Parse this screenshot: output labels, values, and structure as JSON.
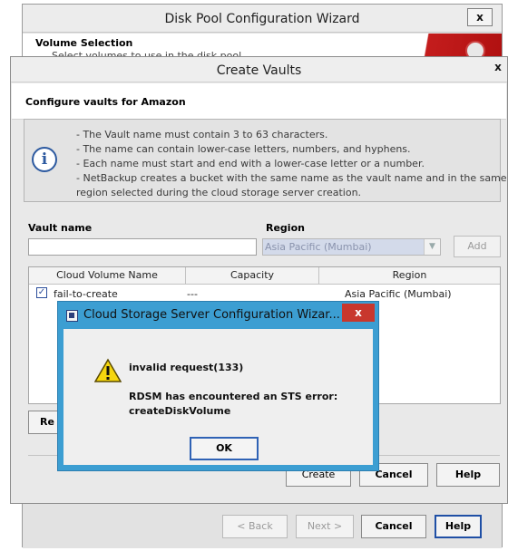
{
  "wizard": {
    "title": "Disk Pool Configuration Wizard",
    "close_label": "x",
    "header_title": "Volume Selection",
    "header_subtitle": "Select volumes to use in the disk pool",
    "buttons": {
      "back": "< Back",
      "back_mnemonic": "B",
      "next": "Next >",
      "cancel": "Cancel",
      "help": "Help"
    }
  },
  "vaults": {
    "title": "Create Vaults",
    "close_label": "x",
    "section_title": "Configure vaults for Amazon",
    "info_lines": [
      "- The Vault name must contain 3 to 63 characters.",
      "- The name can contain lower-case letters, numbers, and hyphens.",
      "- Each name must start and end with a lower-case letter or a number.",
      "- NetBackup creates a bucket with the same name as the vault name and in the same",
      "region selected during the cloud storage server creation."
    ],
    "vault_name_label": "Vault name",
    "vault_name_value": "",
    "region_label": "Region",
    "region_value": "Asia Pacific (Mumbai)",
    "add_button": "Add",
    "table": {
      "columns": [
        "Cloud Volume Name",
        "Capacity",
        "Region"
      ],
      "rows": [
        {
          "checked": true,
          "name": "fail-to-create",
          "capacity": "---",
          "region": "Asia Pacific (Mumbai)"
        }
      ]
    },
    "remove_button": "Re",
    "buttons": {
      "create": "Create",
      "cancel": "Cancel",
      "help": "Help"
    }
  },
  "error_dialog": {
    "title": "Cloud Storage Server Configuration Wizar...",
    "close_label": "x",
    "line1": "invalid request(133)",
    "line2": "RDSM has encountered an STS error:",
    "line3": "createDiskVolume",
    "ok_button": "OK"
  },
  "colors": {
    "modal_frame": "#3c9ed2",
    "modal_close": "#c8372d",
    "focus_border": "#2f62b5"
  }
}
